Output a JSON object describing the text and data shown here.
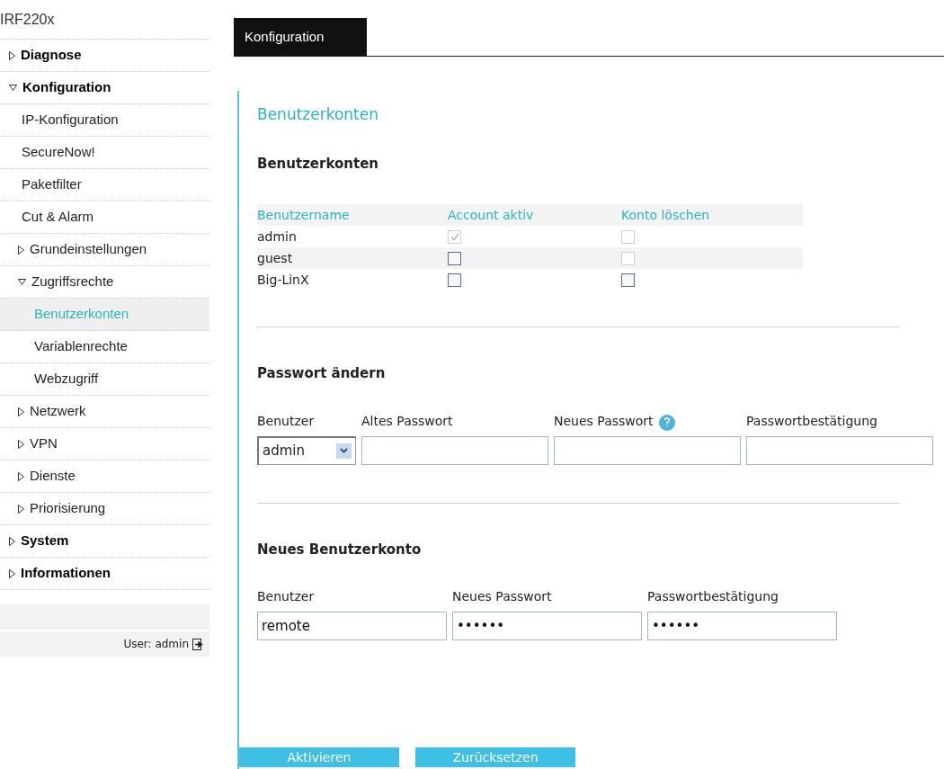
{
  "device": "IRF220x",
  "nav": [
    {
      "label": "Diagnose",
      "expanded": false,
      "selected": false
    },
    {
      "label": "Konfiguration",
      "expanded": true,
      "selected": false,
      "children": [
        {
          "label": "IP-Konfiguration",
          "selected": false
        },
        {
          "label": "SecureNow!",
          "selected": false
        },
        {
          "label": "Paketfilter",
          "selected": false
        },
        {
          "label": "Cut & Alarm",
          "selected": false
        },
        {
          "label": "Grundeinstellungen",
          "expanded": false,
          "selected": false
        },
        {
          "label": "Zugriffsrechte",
          "expanded": true,
          "selected": false,
          "children": [
            {
              "label": "Benutzerkonten",
              "selected": true
            },
            {
              "label": "Variablenrechte",
              "selected": false
            },
            {
              "label": "Webzugriff",
              "selected": false
            }
          ]
        },
        {
          "label": "Netzwerk",
          "expanded": false,
          "selected": false
        },
        {
          "label": "VPN",
          "expanded": false,
          "selected": false
        },
        {
          "label": "Dienste",
          "expanded": false,
          "selected": false
        },
        {
          "label": "Priorisierung",
          "expanded": false,
          "selected": false
        }
      ]
    },
    {
      "label": "System",
      "expanded": false,
      "selected": false
    },
    {
      "label": "Informationen",
      "expanded": false,
      "selected": false
    }
  ],
  "user_label": "User: admin",
  "tabs": [
    {
      "label": "Konfiguration",
      "selected": true
    }
  ],
  "page_title": "Benutzerkonten",
  "accounts": {
    "heading": "Benutzerkonten",
    "columns": [
      "Benutzername",
      "Account aktiv",
      "Konto löschen"
    ],
    "rows": [
      {
        "name": "admin",
        "active": {
          "checked": true,
          "disabled": true
        },
        "delete": {
          "checked": false,
          "disabled": true
        }
      },
      {
        "name": "guest",
        "active": {
          "checked": false,
          "disabled": false
        },
        "delete": {
          "checked": false,
          "disabled": true
        }
      },
      {
        "name": "Big-LinX",
        "active": {
          "checked": false,
          "disabled": false
        },
        "delete": {
          "checked": false,
          "disabled": false
        }
      }
    ]
  },
  "change_password": {
    "heading": "Passwort ändern",
    "user_label": "Benutzer",
    "user_value": "admin",
    "fields": [
      {
        "label": "Altes Passwort",
        "help": false
      },
      {
        "label": "Neues Passwort",
        "help": true
      },
      {
        "label": "Passwortbestätigung",
        "help": false
      }
    ]
  },
  "new_account": {
    "heading": "Neues Benutzerkonto",
    "fields": [
      {
        "label": "Benutzer",
        "value": "remote"
      },
      {
        "label": "Neues Passwort",
        "value": "••••••"
      },
      {
        "label": "Passwortbestätigung",
        "value": "••••••"
      }
    ]
  },
  "buttons": [
    "Aktivieren",
    "Zurücksetzen"
  ]
}
